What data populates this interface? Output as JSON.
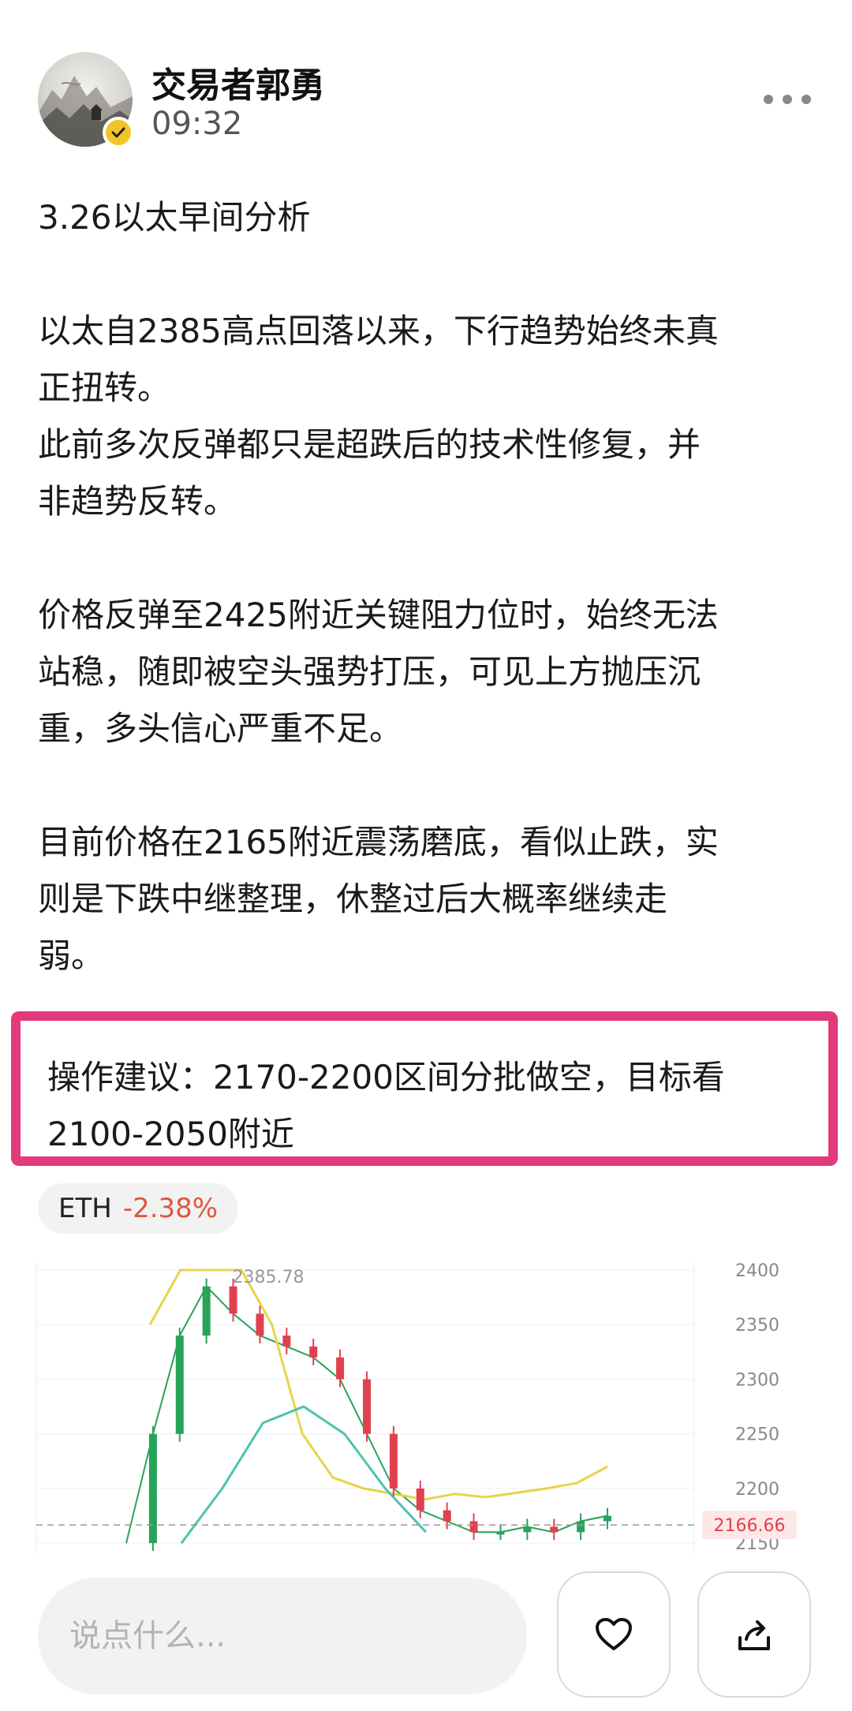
{
  "author": {
    "name": "交易者郭勇",
    "time": "09:32",
    "verified_color": "#f3c42a"
  },
  "post": {
    "title": "3.26以太早间分析",
    "paragraphs": [
      "以太自2385高点回落以来，下行趋势始终未真\n正扭转。\n此前多次反弹都只是超跌后的技术性修复，并\n非趋势反转。",
      "价格反弹至2425附近关键阻力位时，始终无法\n站稳，随即被空头强势打压，可见上方抛压沉\n重，多头信心严重不足。",
      "目前价格在2165附近震荡磨底，看似止跌，实\n则是下跌中继整理，休整过后大概率继续走\n弱。"
    ],
    "advice": "操作建议：2170-2200区间分批做空，目标看\n2100-2050附近",
    "advice_border_color": "#e23a7c"
  },
  "coin": {
    "symbol": "ETH",
    "change": "-2.38%",
    "change_color": "#e0573d"
  },
  "chart_data": {
    "type": "line",
    "title": "",
    "xlabel": "",
    "ylabel": "",
    "ylim": [
      2140,
      2400
    ],
    "y_ticks": [
      2400,
      2350,
      2300,
      2250,
      2200,
      2150
    ],
    "annotations": [
      "2385.78"
    ],
    "current_price": "2166.66",
    "series": [
      {
        "values": [
          2150,
          2250,
          2340,
          2385,
          2360,
          2340,
          2330,
          2320,
          2300,
          2250,
          2200,
          2180,
          2170,
          2160,
          2160,
          2165,
          2160,
          2170,
          2175
        ]
      },
      {
        "values": [
          2350,
          2400,
          2400,
          2400,
          2350,
          2250,
          2210,
          2200,
          2195,
          2190,
          2195,
          2192,
          2196,
          2200,
          2205,
          2220
        ]
      },
      {
        "values": [
          2150,
          2200,
          2260,
          2275,
          2250,
          2200,
          2160
        ]
      }
    ],
    "colors": {
      "up": "#27a35a",
      "down": "#e0414f",
      "ma_yellow": "#e8d34a",
      "ma_teal": "#4fc3b1",
      "price_line": "#f08a8a"
    }
  },
  "composer": {
    "placeholder": "说点什么...",
    "like_icon": "heart-icon",
    "share_icon": "share-icon"
  }
}
